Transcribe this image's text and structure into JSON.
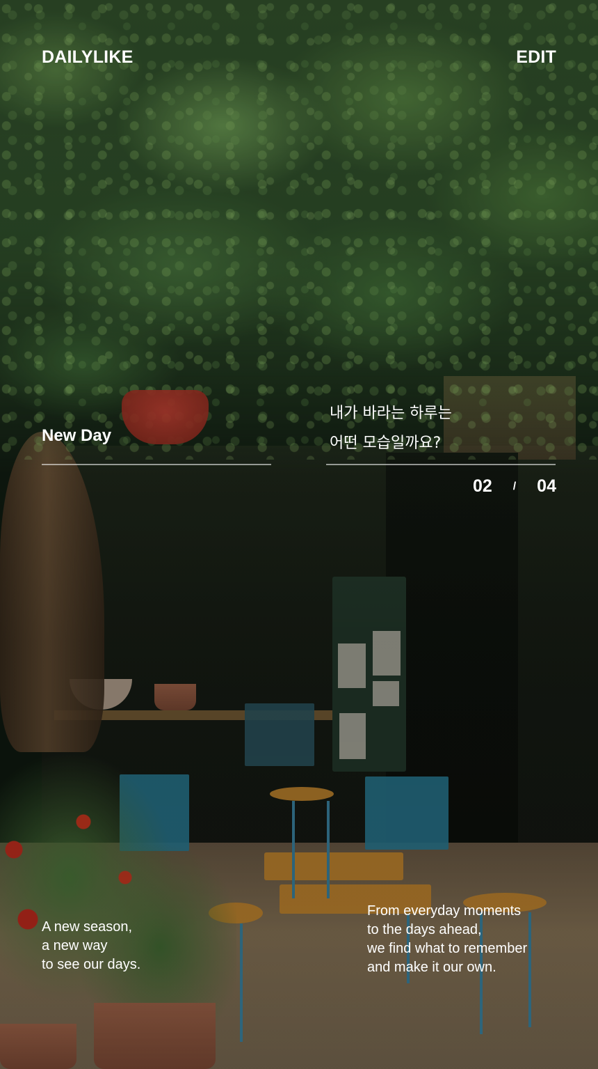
{
  "header": {
    "brand": "DAILYLIKE",
    "edit_label": "EDIT"
  },
  "hero": {
    "left_title": "New Day",
    "right_title_lines": [
      "내가 바라는 하루는",
      "어떤 모습일까요?"
    ]
  },
  "pager": {
    "current": "02",
    "separator": "/",
    "total": "04"
  },
  "captions": {
    "left_lines": [
      "A new season,",
      "a new way",
      "to see our days."
    ],
    "right_lines": [
      "From everyday moments",
      "to the days ahead,",
      "we find what to remember",
      "and make it our own."
    ]
  },
  "colors": {
    "text": "#ffffff",
    "divider": "#ffffff"
  }
}
